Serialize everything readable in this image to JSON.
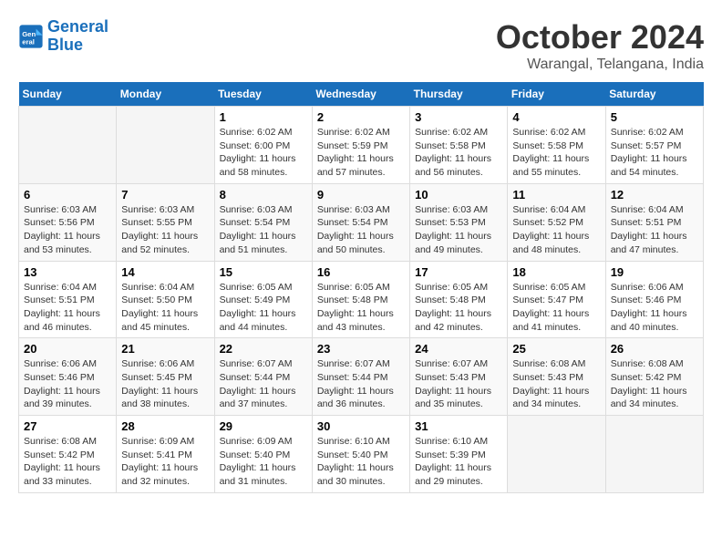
{
  "logo": {
    "line1": "General",
    "line2": "Blue"
  },
  "title": "October 2024",
  "subtitle": "Warangal, Telangana, India",
  "days_of_week": [
    "Sunday",
    "Monday",
    "Tuesday",
    "Wednesday",
    "Thursday",
    "Friday",
    "Saturday"
  ],
  "weeks": [
    [
      {
        "day": "",
        "info": ""
      },
      {
        "day": "",
        "info": ""
      },
      {
        "day": "1",
        "info": "Sunrise: 6:02 AM\nSunset: 6:00 PM\nDaylight: 11 hours and 58 minutes."
      },
      {
        "day": "2",
        "info": "Sunrise: 6:02 AM\nSunset: 5:59 PM\nDaylight: 11 hours and 57 minutes."
      },
      {
        "day": "3",
        "info": "Sunrise: 6:02 AM\nSunset: 5:58 PM\nDaylight: 11 hours and 56 minutes."
      },
      {
        "day": "4",
        "info": "Sunrise: 6:02 AM\nSunset: 5:58 PM\nDaylight: 11 hours and 55 minutes."
      },
      {
        "day": "5",
        "info": "Sunrise: 6:02 AM\nSunset: 5:57 PM\nDaylight: 11 hours and 54 minutes."
      }
    ],
    [
      {
        "day": "6",
        "info": "Sunrise: 6:03 AM\nSunset: 5:56 PM\nDaylight: 11 hours and 53 minutes."
      },
      {
        "day": "7",
        "info": "Sunrise: 6:03 AM\nSunset: 5:55 PM\nDaylight: 11 hours and 52 minutes."
      },
      {
        "day": "8",
        "info": "Sunrise: 6:03 AM\nSunset: 5:54 PM\nDaylight: 11 hours and 51 minutes."
      },
      {
        "day": "9",
        "info": "Sunrise: 6:03 AM\nSunset: 5:54 PM\nDaylight: 11 hours and 50 minutes."
      },
      {
        "day": "10",
        "info": "Sunrise: 6:03 AM\nSunset: 5:53 PM\nDaylight: 11 hours and 49 minutes."
      },
      {
        "day": "11",
        "info": "Sunrise: 6:04 AM\nSunset: 5:52 PM\nDaylight: 11 hours and 48 minutes."
      },
      {
        "day": "12",
        "info": "Sunrise: 6:04 AM\nSunset: 5:51 PM\nDaylight: 11 hours and 47 minutes."
      }
    ],
    [
      {
        "day": "13",
        "info": "Sunrise: 6:04 AM\nSunset: 5:51 PM\nDaylight: 11 hours and 46 minutes."
      },
      {
        "day": "14",
        "info": "Sunrise: 6:04 AM\nSunset: 5:50 PM\nDaylight: 11 hours and 45 minutes."
      },
      {
        "day": "15",
        "info": "Sunrise: 6:05 AM\nSunset: 5:49 PM\nDaylight: 11 hours and 44 minutes."
      },
      {
        "day": "16",
        "info": "Sunrise: 6:05 AM\nSunset: 5:48 PM\nDaylight: 11 hours and 43 minutes."
      },
      {
        "day": "17",
        "info": "Sunrise: 6:05 AM\nSunset: 5:48 PM\nDaylight: 11 hours and 42 minutes."
      },
      {
        "day": "18",
        "info": "Sunrise: 6:05 AM\nSunset: 5:47 PM\nDaylight: 11 hours and 41 minutes."
      },
      {
        "day": "19",
        "info": "Sunrise: 6:06 AM\nSunset: 5:46 PM\nDaylight: 11 hours and 40 minutes."
      }
    ],
    [
      {
        "day": "20",
        "info": "Sunrise: 6:06 AM\nSunset: 5:46 PM\nDaylight: 11 hours and 39 minutes."
      },
      {
        "day": "21",
        "info": "Sunrise: 6:06 AM\nSunset: 5:45 PM\nDaylight: 11 hours and 38 minutes."
      },
      {
        "day": "22",
        "info": "Sunrise: 6:07 AM\nSunset: 5:44 PM\nDaylight: 11 hours and 37 minutes."
      },
      {
        "day": "23",
        "info": "Sunrise: 6:07 AM\nSunset: 5:44 PM\nDaylight: 11 hours and 36 minutes."
      },
      {
        "day": "24",
        "info": "Sunrise: 6:07 AM\nSunset: 5:43 PM\nDaylight: 11 hours and 35 minutes."
      },
      {
        "day": "25",
        "info": "Sunrise: 6:08 AM\nSunset: 5:43 PM\nDaylight: 11 hours and 34 minutes."
      },
      {
        "day": "26",
        "info": "Sunrise: 6:08 AM\nSunset: 5:42 PM\nDaylight: 11 hours and 34 minutes."
      }
    ],
    [
      {
        "day": "27",
        "info": "Sunrise: 6:08 AM\nSunset: 5:42 PM\nDaylight: 11 hours and 33 minutes."
      },
      {
        "day": "28",
        "info": "Sunrise: 6:09 AM\nSunset: 5:41 PM\nDaylight: 11 hours and 32 minutes."
      },
      {
        "day": "29",
        "info": "Sunrise: 6:09 AM\nSunset: 5:40 PM\nDaylight: 11 hours and 31 minutes."
      },
      {
        "day": "30",
        "info": "Sunrise: 6:10 AM\nSunset: 5:40 PM\nDaylight: 11 hours and 30 minutes."
      },
      {
        "day": "31",
        "info": "Sunrise: 6:10 AM\nSunset: 5:39 PM\nDaylight: 11 hours and 29 minutes."
      },
      {
        "day": "",
        "info": ""
      },
      {
        "day": "",
        "info": ""
      }
    ]
  ]
}
